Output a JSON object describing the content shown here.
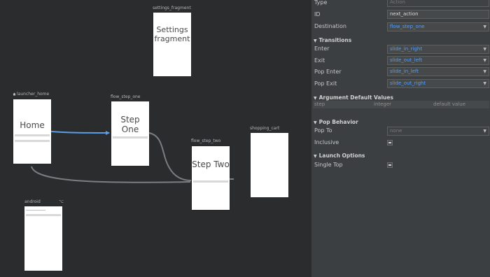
{
  "graph": {
    "settings_fragment": {
      "label": "settings_fragment",
      "title": "Settings fragment"
    },
    "launcher_home": {
      "label": "launcher_home",
      "title": "Home"
    },
    "flow_step_one": {
      "label": "flow_step_one",
      "title": "Step One"
    },
    "flow_step_two": {
      "label": "flow_step_two",
      "title": "Step Two"
    },
    "shopping_cart": {
      "label": "shopping_cart"
    },
    "android": {
      "label": "android",
      "badge": "⌥"
    }
  },
  "panel": {
    "type": {
      "label": "Type",
      "value": "Action"
    },
    "id": {
      "label": "ID",
      "value": "next_action"
    },
    "destination": {
      "label": "Destination",
      "value": "flow_step_one"
    },
    "transitions": {
      "title": "Transitions",
      "enter": {
        "label": "Enter",
        "value": "slide_in_right"
      },
      "exit": {
        "label": "Exit",
        "value": "slide_out_left"
      },
      "pop_enter": {
        "label": "Pop Enter",
        "value": "slide_in_left"
      },
      "pop_exit": {
        "label": "Pop Exit",
        "value": "slide_out_right"
      }
    },
    "arguments": {
      "title": "Argument Default Values",
      "columns": [
        "step",
        "integer",
        "default value"
      ]
    },
    "pop_behavior": {
      "title": "Pop Behavior",
      "pop_to": {
        "label": "Pop To",
        "value": "none"
      },
      "inclusive": {
        "label": "Inclusive"
      }
    },
    "launch_options": {
      "title": "Launch Options",
      "single_top": {
        "label": "Single Top"
      }
    }
  },
  "colors": {
    "accent": "#589df6",
    "edge_selected": "#5a9ee8",
    "edge": "#7b7d80"
  }
}
